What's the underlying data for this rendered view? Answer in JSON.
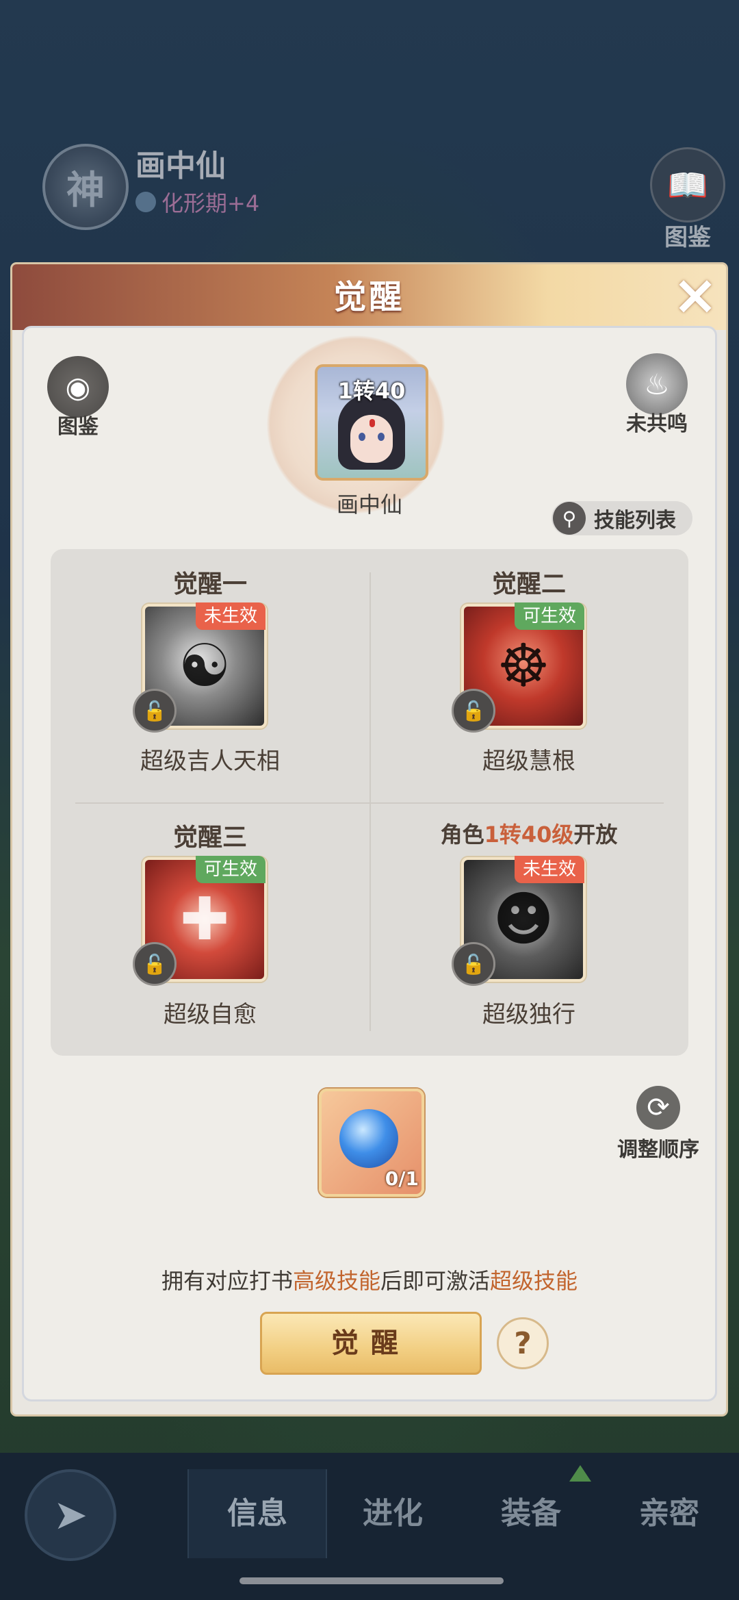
{
  "background": {
    "char_badge": "神",
    "char_name": "画中仙",
    "char_realm": "化形期+4",
    "top_atlas_label": "图鉴"
  },
  "dialog": {
    "title": "觉醒",
    "close_icon": "×",
    "atlas_label": "图鉴",
    "resonance_label": "未共鸣",
    "portrait": {
      "level": "1转40",
      "name": "画中仙"
    },
    "skill_list_label": "技能列表",
    "awakenings": [
      {
        "title": "觉醒一",
        "status": "未生效",
        "skill": "超级吉人天相"
      },
      {
        "title": "觉醒二",
        "status": "可生效",
        "skill": "超级慧根"
      },
      {
        "title": "觉醒三",
        "status": "可生效",
        "skill": "超级自愈"
      },
      {
        "title_prefix": "角色",
        "title_highlight": "1转40级",
        "title_suffix": "开放",
        "status": "未生效",
        "skill": "超级独行"
      }
    ],
    "item_count": "0/1",
    "reorder_label": "调整顺序",
    "hint": {
      "p1": "拥有对应打书",
      "h1": "高级技能",
      "p2": "后即可激活",
      "h2": "超级技能"
    },
    "awaken_button": "觉醒",
    "help_icon": "?"
  },
  "nav": {
    "tabs": [
      "信息",
      "进化",
      "装备",
      "亲密"
    ]
  },
  "colors": {
    "highlight": "#c2652e",
    "tag_inactive": "#e9624a",
    "tag_active": "#5fa85e"
  }
}
